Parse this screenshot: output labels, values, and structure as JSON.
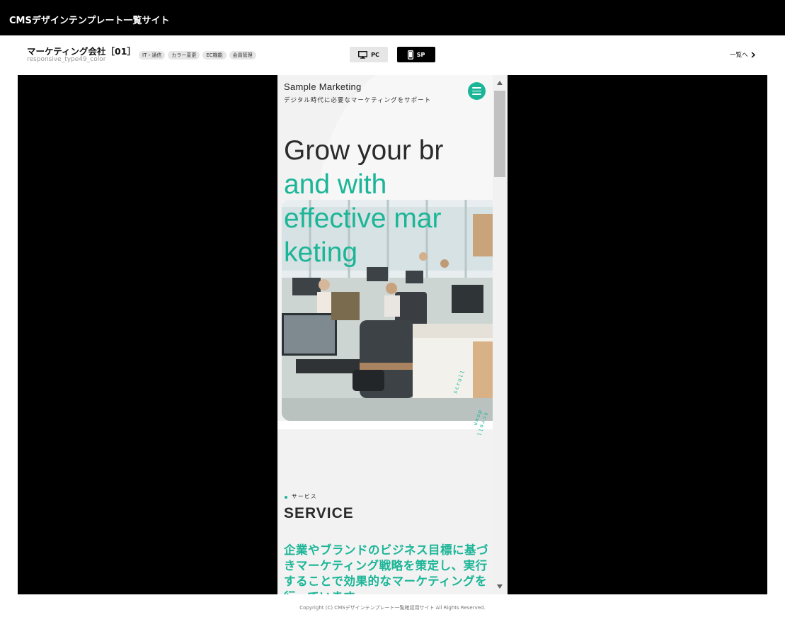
{
  "site": {
    "title": "CMSデザインテンプレート一覧サイト"
  },
  "template": {
    "title": "マーケティング会社［01］",
    "subtitle": "responsive_type49_color",
    "tags": [
      "IT・通信",
      "カラー変更",
      "EC機能",
      "会員管理"
    ]
  },
  "device_toggle": {
    "pc_label": "PC",
    "sp_label": "SP",
    "selected": "SP"
  },
  "nav": {
    "list_link": "一覧へ"
  },
  "preview": {
    "brand": "Sample Marketing",
    "tagline": "デジタル時代に必要なマーケティングをサポート",
    "hero_lines": [
      "Grow your br",
      "and with",
      "effective mar",
      "keting"
    ],
    "scroll_label": "scroll",
    "scroll_label_2": "scroll down",
    "service": {
      "kicker": "サービス",
      "title": "SERVICE",
      "lead": "企業やブランドのビジネス目標に基づきマーケティング戦略を策定し、実行することで効果的なマーケティングを行っています。"
    },
    "colors": {
      "accent": "#1bb597",
      "text_dark": "#2b2b2b",
      "background": "#f2f2f2"
    },
    "icons": {
      "menu": "hamburger-menu-icon"
    }
  },
  "footer": {
    "copyright": "Copyright (C) CMSデザインテンプレート一覧確認用サイト All Rights Reserved."
  }
}
